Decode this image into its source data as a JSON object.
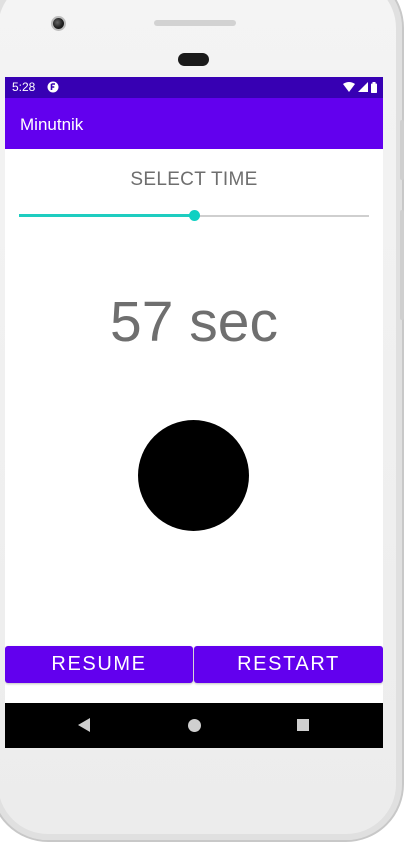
{
  "status_bar": {
    "time": "5:28",
    "icons": [
      "wifi-icon",
      "signal-icon",
      "battery-icon"
    ],
    "background": "#3700b3"
  },
  "app_bar": {
    "title": "Minutnik",
    "background": "#6200ee"
  },
  "timer": {
    "select_label": "SELECT TIME",
    "slider_fraction": 0.5,
    "slider_color": "#1ecdc0",
    "display": "57 sec",
    "circle_color": "#000000"
  },
  "buttons": {
    "resume_label": "RESUME",
    "restart_label": "RESTART",
    "color": "#6200ee"
  },
  "nav_bar": {
    "icons": [
      "back-icon",
      "home-icon",
      "recents-icon"
    ]
  }
}
